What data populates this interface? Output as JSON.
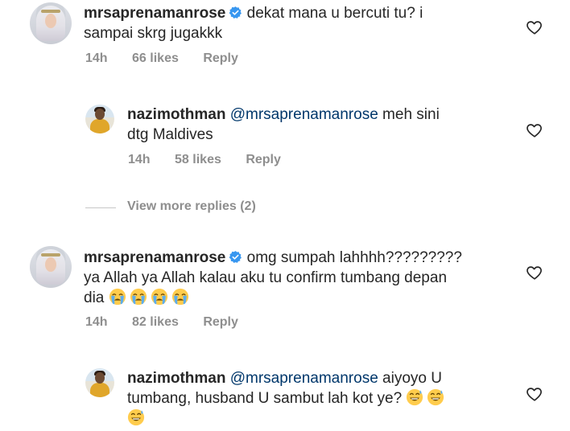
{
  "comments": [
    {
      "username": "mrsaprenamanrose",
      "verified": true,
      "text": "dekat mana u bercuti tu? i sampai skrg jugakkk",
      "line1": "dekat mana u bercuti tu? i",
      "line2": "sampai skrg jugakkk",
      "time": "14h",
      "likes": "66 likes",
      "reply": "Reply"
    },
    {
      "username": "nazimothman",
      "mention": "@mrsaprenamanrose",
      "line1_rest": "meh sini",
      "line2": "dtg Maldives",
      "time": "14h",
      "likes": "58 likes",
      "reply": "Reply"
    },
    {
      "username": "mrsaprenamanrose",
      "verified": true,
      "line1": "omg sumpah lahhhh?????????",
      "line2": "ya Allah ya Allah kalau aku tu confirm tumbang depan",
      "line3": "dia",
      "emojis": [
        "loudly-crying-face",
        "loudly-crying-face",
        "loudly-crying-face",
        "loudly-crying-face"
      ],
      "time": "14h",
      "likes": "82 likes",
      "reply": "Reply"
    },
    {
      "username": "nazimothman",
      "mention": "@mrsaprenamanrose",
      "line1_rest": "aiyoyo U",
      "line2": "tumbang, husband U sambut lah kot ye?",
      "emojis": [
        "grinning-sweat-face",
        "grinning-sweat-face",
        "grinning-sweat-face"
      ]
    }
  ],
  "view_more": "View more replies (2)",
  "colors": {
    "text": "#262626",
    "meta": "#8e8e8e",
    "mention": "#00376b",
    "verified": "#3897f0"
  }
}
